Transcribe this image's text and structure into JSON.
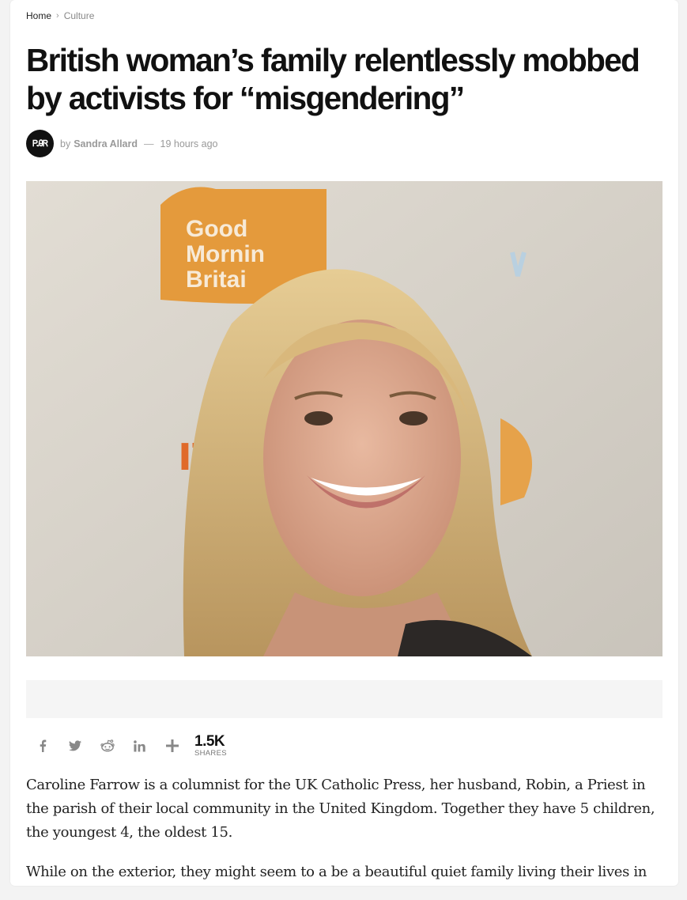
{
  "breadcrumb": {
    "home": "Home",
    "category": "Culture"
  },
  "article": {
    "title": "British woman’s family relentlessly mobbed by activists for “misgendering”",
    "avatar_text": "ᏢᎯᏒ",
    "by": "by",
    "author": "Sandra Allard",
    "dash": "—",
    "time": "19 hours ago",
    "hero_sign_text": [
      "Good",
      "Mornin",
      "Britai"
    ],
    "hero_logo_text": "ıt"
  },
  "share": {
    "buttons": [
      {
        "name": "facebook-icon",
        "glyph": "f"
      },
      {
        "name": "twitter-icon",
        "glyph": "twitter"
      },
      {
        "name": "reddit-icon",
        "glyph": "reddit"
      },
      {
        "name": "linkedin-icon",
        "glyph": "in"
      },
      {
        "name": "plus-icon",
        "glyph": "+"
      }
    ],
    "count": "1.5K",
    "count_label": "SHARES"
  },
  "body": {
    "paragraph_1": "Caroline Farrow is a columnist for the UK Catholic Press, her husband, Robin, a Priest in the parish of their local community in the United Kingdom. Together they have 5 children, the youngest 4, the oldest 15.",
    "paragraph_2": "While on the exterior, they might seem to a be a beautiful quiet family living their lives in"
  },
  "colors": {
    "accent_orange": "#e49a3c",
    "text_dark": "#111111",
    "muted": "#999999"
  }
}
